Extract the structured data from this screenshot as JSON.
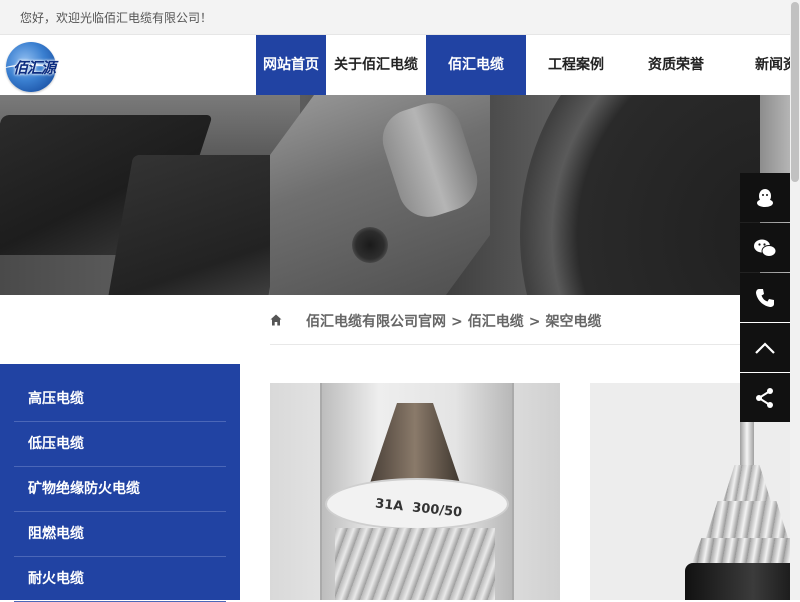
{
  "topbar": {
    "welcome": "您好，欢迎光临佰汇电缆有限公司！"
  },
  "logo": {
    "text": "佰汇源"
  },
  "nav": {
    "items": [
      {
        "label": "网站首页"
      },
      {
        "label": "关于佰汇电缆"
      },
      {
        "label": "佰汇电缆"
      },
      {
        "label": "工程案例"
      },
      {
        "label": "资质荣誉"
      },
      {
        "label": "新闻资"
      }
    ],
    "active_color": "#2143a3"
  },
  "breadcrumb": {
    "home_icon": "home-icon",
    "items": [
      "佰汇电缆有限公司官网",
      "佰汇电缆",
      "架空电缆"
    ],
    "separator": ">"
  },
  "sidebar": {
    "background": "#2143a3",
    "items": [
      "高压电缆",
      "低压电缆",
      "矿物绝缘防火电缆",
      "阻燃电缆",
      "耐火电缆"
    ]
  },
  "products": {
    "p1_ring_text": "300/50",
    "p1_ring_prefix": "31A"
  },
  "float_tools": {
    "icons": [
      "qq-icon",
      "wechat-icon",
      "phone-icon",
      "back-to-top-icon",
      "share-icon"
    ]
  }
}
